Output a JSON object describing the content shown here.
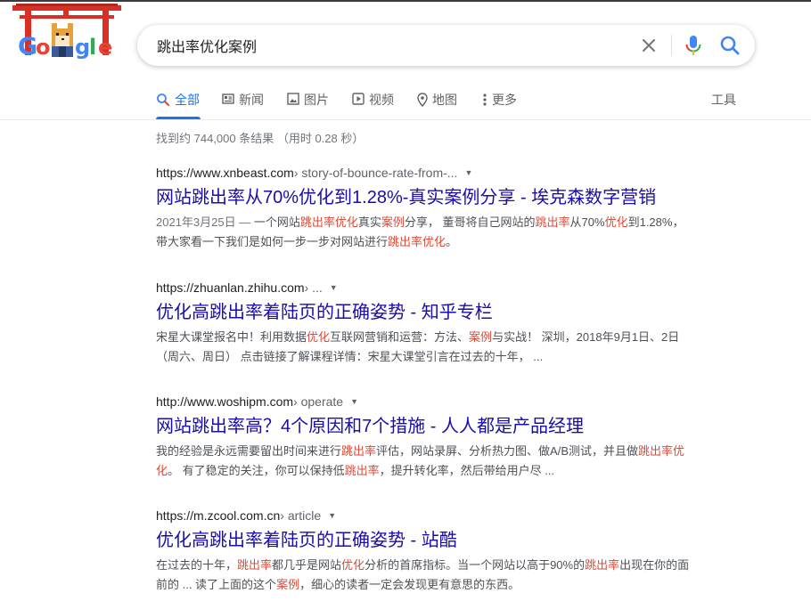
{
  "search": {
    "query": "跳出率优化案例"
  },
  "tabs": [
    {
      "label": "全部",
      "icon": "search-icon"
    },
    {
      "label": "新闻",
      "icon": "news-icon"
    },
    {
      "label": "图片",
      "icon": "image-icon"
    },
    {
      "label": "视频",
      "icon": "video-icon"
    },
    {
      "label": "地图",
      "icon": "map-pin-icon"
    },
    {
      "label": "更多",
      "icon": "more-vert-icon"
    }
  ],
  "tools_label": "工具",
  "stats": "找到约 744,000 条结果 （用时 0.28 秒）",
  "colors": {
    "link": "#1a0dab",
    "accent": "#1a73e8",
    "highlight": "#dd4b39"
  },
  "results": [
    {
      "url_host": "https://www.xnbeast.com",
      "url_path": " › story-of-bounce-rate-from-...",
      "title": "网站跳出率从70%优化到1.28%-真实案例分享 - 埃克森数字营销",
      "snippet": [
        {
          "t": "2021年3月25日 — ",
          "style": "date"
        },
        {
          "t": "一个网站"
        },
        {
          "t": "跳出率优化",
          "style": "hl"
        },
        {
          "t": "真实"
        },
        {
          "t": "案例",
          "style": "hl"
        },
        {
          "t": "分享， 董哥将自己网站的"
        },
        {
          "t": "跳出率",
          "style": "hl"
        },
        {
          "t": "从70%"
        },
        {
          "t": "优化",
          "style": "hl"
        },
        {
          "t": "到1.28%，带大家看一下我们是如何一步一步对网站进行"
        },
        {
          "t": "跳出率优化",
          "style": "hl"
        },
        {
          "t": "。"
        }
      ]
    },
    {
      "url_host": "https://zhuanlan.zhihu.com",
      "url_path": " › ...",
      "title": "优化高跳出率着陆页的正确姿势 - 知乎专栏",
      "snippet": [
        {
          "t": "宋星大课堂报名中！利用数据"
        },
        {
          "t": "优化",
          "style": "hl"
        },
        {
          "t": "互联网营销和运营：方法、"
        },
        {
          "t": "案例",
          "style": "hl"
        },
        {
          "t": "与实战！ 深圳，2018年9月1日、2日（周六、周日） 点击链接了解课程详情：宋星大课堂引言在过去的十年， ..."
        }
      ]
    },
    {
      "url_host": "http://www.woshipm.com",
      "url_path": " › operate",
      "title": "网站跳出率高？4个原因和7个措施 - 人人都是产品经理",
      "snippet": [
        {
          "t": "我的经验是永远需要留出时间来进行"
        },
        {
          "t": "跳出率",
          "style": "hl"
        },
        {
          "t": "评估，网站录屏、分析热力图、做A/B测试，并且做"
        },
        {
          "t": "跳出率优化",
          "style": "hl"
        },
        {
          "t": "。 有了稳定的关注，你可以保持低"
        },
        {
          "t": "跳出率",
          "style": "hl"
        },
        {
          "t": "，提升转化率，然后带给用户尽 ..."
        }
      ]
    },
    {
      "url_host": "https://m.zcool.com.cn",
      "url_path": " › article",
      "title": "优化高跳出率着陆页的正确姿势 - 站酷",
      "snippet": [
        {
          "t": "在过去的十年，"
        },
        {
          "t": "跳出率",
          "style": "hl"
        },
        {
          "t": "都几乎是网站"
        },
        {
          "t": "优化",
          "style": "hl"
        },
        {
          "t": "分析的首席指标。当一个网站以高于90%的"
        },
        {
          "t": "跳出率",
          "style": "hl"
        },
        {
          "t": "出现在你的面前的 ... 读了上面的这个"
        },
        {
          "t": "案例",
          "style": "hl"
        },
        {
          "t": "，细心的读者一定会发现更有意思的东西。"
        }
      ]
    }
  ]
}
